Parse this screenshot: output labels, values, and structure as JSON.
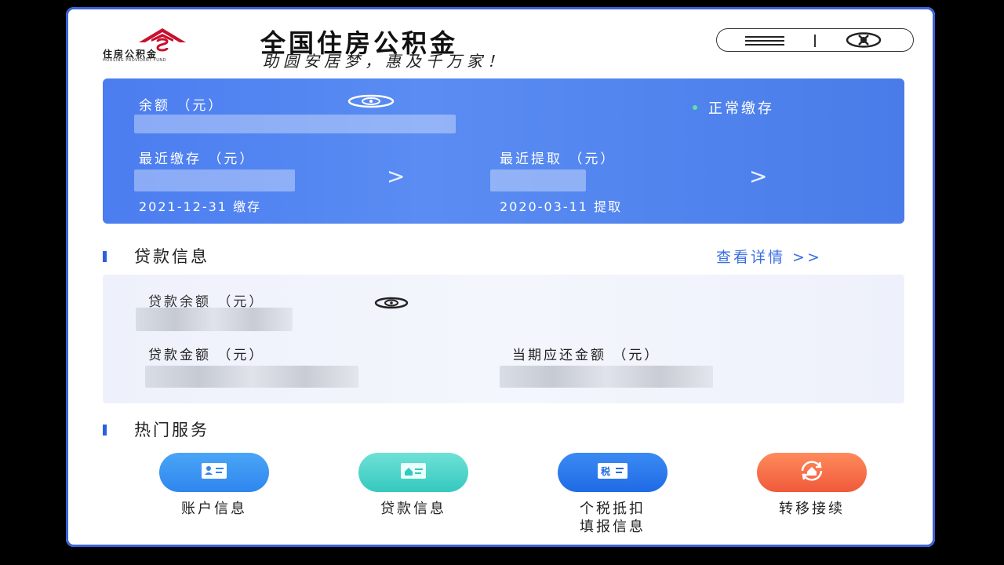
{
  "header": {
    "logo_text": "住房公积金",
    "logo_subtext": "HOUSING PROVIDENT FUND",
    "title": "全国住房公积金",
    "slogan": "助圆安居梦，惠及千万家！"
  },
  "balance_card": {
    "balance_label": "余额 （元）",
    "status": "正常缴存",
    "recent_deposit_label": "最近缴存 （元）",
    "recent_deposit_date": "2021-12-31 缴存",
    "recent_withdraw_label": "最近提取 （元）",
    "recent_withdraw_date": "2020-03-11 提取"
  },
  "loan_section": {
    "title": "贷款信息",
    "detail_link": "查看详情 >>",
    "loan_balance_label": "贷款余额 （元）",
    "loan_amount_label": "贷款金额 （元）",
    "current_due_label": "当期应还金额 （元）"
  },
  "hot_services": {
    "title": "热门服务",
    "items": [
      {
        "label": "账户信息",
        "icon": "id-card-icon",
        "color": "#2f8ef0"
      },
      {
        "label": "贷款信息",
        "icon": "house-card-icon",
        "color": "#3fcfc4"
      },
      {
        "label": "个税抵扣\n填报信息",
        "icon": "tax-card-icon",
        "color": "#2a78ea"
      },
      {
        "label": "转移接续",
        "icon": "transfer-house-icon",
        "color": "#f36b48"
      }
    ]
  },
  "colors": {
    "card_gradient_start": "#4b7df0",
    "card_gradient_end": "#4a7ce9",
    "accent": "#3c6fe3",
    "status_dot": "#5fe2a6"
  }
}
